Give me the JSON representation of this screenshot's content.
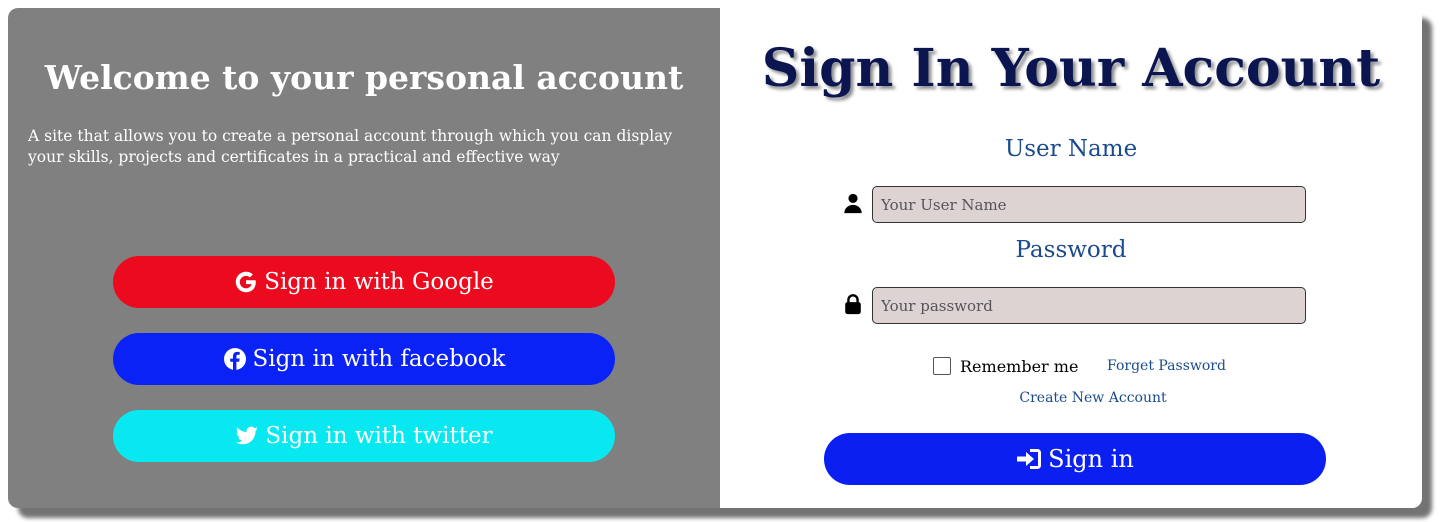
{
  "colors": {
    "left_panel_bg": "#808080",
    "google": "#ec0a1e",
    "facebook": "#0a22f5",
    "twitter": "#08e8f0",
    "title": "#0b1550",
    "label": "#1a4b8c",
    "link": "#1a4b8c",
    "signin_button": "#0a1ff0"
  },
  "left": {
    "heading": "Welcome to your personal account",
    "description": "A site that allows you to create a personal account through which you can display your skills, projects and certificates in a practical and effective way",
    "google_label": "Sign in with Google",
    "facebook_label": "Sign in with facebook",
    "twitter_label": "Sign in with twitter"
  },
  "right": {
    "title": "Sign In Your Account",
    "username_label": "User Name",
    "username_placeholder": "Your User Name",
    "password_label": "Password",
    "password_placeholder": "Your password",
    "remember_label": "Remember me",
    "forget_label": "Forget Password",
    "create_label": "Create New Account",
    "signin_label": "Sign in"
  },
  "icons": {
    "google": "google-icon",
    "facebook": "facebook-icon",
    "twitter": "twitter-icon",
    "user": "user-icon",
    "lock": "lock-icon",
    "signin": "sign-in-icon"
  }
}
